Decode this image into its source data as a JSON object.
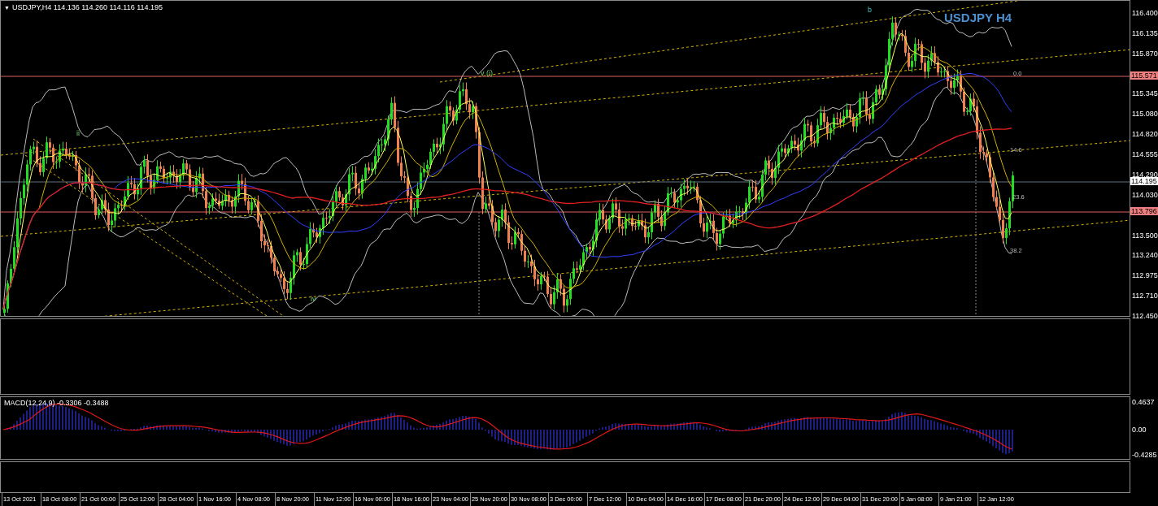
{
  "header": {
    "glyph": "▼",
    "text": "USDJPY,H4 114.136 114.260 114.116 114.195"
  },
  "chart_title": "USDJPY H4",
  "wave_labels": [
    "ii",
    "iv",
    "v (i)",
    "b"
  ],
  "fib_labels": [
    "0.0",
    "14.6",
    "23.6",
    "38.2"
  ],
  "price_axis": {
    "ticks": [
      "116.400",
      "116.135",
      "115.870",
      "115.345",
      "115.080",
      "114.820",
      "114.555",
      "114.290",
      "114.030",
      "113.500",
      "113.240",
      "112.975",
      "112.710",
      "112.450"
    ],
    "markers": [
      {
        "label": "115.571",
        "kind": "line"
      },
      {
        "label": "114.195",
        "kind": "bid"
      },
      {
        "label": "113.796",
        "kind": "line"
      }
    ]
  },
  "macd": {
    "label": "MACD(12,24,9) -0.3306 -0.3488",
    "ticks": [
      "0.4637",
      "0.00",
      "-0.4285"
    ]
  },
  "time_axis": [
    "13 Oct 2021",
    "18 Oct 08:00",
    "21 Oct 00:00",
    "25 Oct 12:00",
    "28 Oct 04:00",
    "1 Nov 16:00",
    "4 Nov 08:00",
    "8 Nov 20:00",
    "11 Nov 12:00",
    "16 Nov 00:00",
    "18 Nov 16:00",
    "23 Nov 04:00",
    "25 Nov 20:00",
    "30 Nov 08:00",
    "3 Dec 00:00",
    "7 Dec 12:00",
    "10 Dec 04:00",
    "14 Dec 16:00",
    "17 Dec 08:00",
    "21 Dec 20:00",
    "24 Dec 12:00",
    "29 Dec 04:00",
    "31 Dec 20:00",
    "5 Jan 08:00",
    "9 Jan 21:00",
    "12 Jan 12:00"
  ]
}
